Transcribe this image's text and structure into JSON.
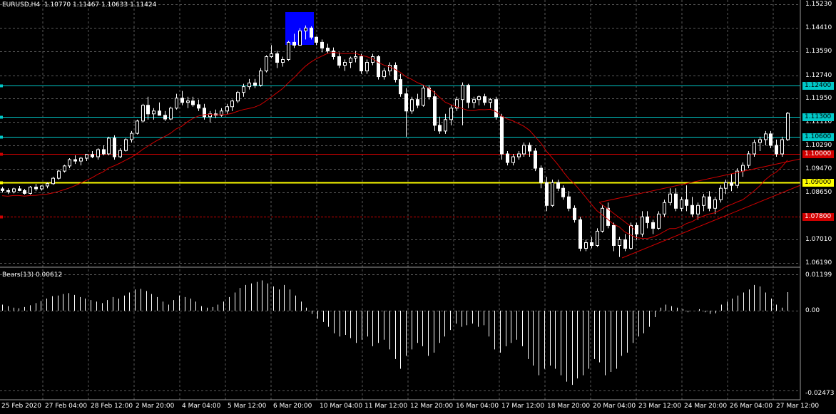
{
  "header": {
    "symbol": "EURUSD,H4",
    "ohlc": "1.10770 1.11467 1.10633 1.11424"
  },
  "indicator": {
    "label": "Bears(13) 0.00612",
    "scale": [
      "0.01199",
      "0.00",
      "-0.02473"
    ]
  },
  "price_axis": [
    "1.15230",
    "1.14410",
    "1.13590",
    "1.12740",
    "1.11950",
    "1.11110",
    "1.10290",
    "1.09470",
    "1.08650",
    "1.07010",
    "1.06190"
  ],
  "hlines": [
    {
      "label": "1.12400",
      "price": 1.124,
      "color": "#00c8c8",
      "text": "#000000"
    },
    {
      "label": "1.11300",
      "price": 1.113,
      "color": "#00c8c8",
      "text": "#000000"
    },
    {
      "label": "1.10600",
      "price": 1.106,
      "color": "#00c8c8",
      "text": "#000000"
    },
    {
      "label": "1.10000",
      "price": 1.1,
      "color": "#d00000",
      "text": "#ffffff"
    },
    {
      "label": "1.09000",
      "price": 1.09,
      "color": "#ffff00",
      "text": "#000000"
    },
    {
      "label": "1.07800",
      "price": 1.078,
      "color": "#d00000",
      "text": "#ffffff",
      "dashed": true
    }
  ],
  "time_axis": [
    "25 Feb 2020",
    "27 Feb 04:00",
    "28 Feb 12:00",
    "2 Mar 20:00",
    "4 Mar 04:00",
    "5 Mar 12:00",
    "6 Mar 20:00",
    "10 Mar 04:00",
    "11 Mar 12:00",
    "12 Mar 20:00",
    "16 Mar 04:00",
    "17 Mar 12:00",
    "18 Mar 20:00",
    "20 Mar 04:00",
    "23 Mar 12:00",
    "24 Mar 20:00",
    "26 Mar 04:00",
    "27 Mar 12:00"
  ],
  "colors": {
    "bull": "#ffffff",
    "bear": "#ffffff",
    "ma": "#d00000",
    "grid": "#5a5a5a",
    "trend": "#d00000",
    "highlight": "#0000ff"
  },
  "ma_period": 13,
  "candles": [
    [
      1.0878,
      1.0885,
      1.0865,
      1.0872
    ],
    [
      1.0872,
      1.088,
      1.086,
      1.0868
    ],
    [
      1.0868,
      1.0882,
      1.0862,
      1.0878
    ],
    [
      1.0878,
      1.0888,
      1.087,
      1.0872
    ],
    [
      1.0872,
      1.0878,
      1.0858,
      1.0862
    ],
    [
      1.0862,
      1.0888,
      1.0858,
      1.0884
    ],
    [
      1.0884,
      1.0895,
      1.087,
      1.0878
    ],
    [
      1.0878,
      1.089,
      1.0872,
      1.0888
    ],
    [
      1.0888,
      1.09,
      1.088,
      1.0896
    ],
    [
      1.0896,
      1.092,
      1.0892,
      1.0915
    ],
    [
      1.0915,
      1.0945,
      1.091,
      1.094
    ],
    [
      1.094,
      1.0962,
      1.0935,
      1.0958
    ],
    [
      1.0958,
      1.0985,
      1.095,
      1.098
    ],
    [
      1.098,
      1.0995,
      1.0965,
      1.0975
    ],
    [
      1.0975,
      1.099,
      1.096,
      1.0985
    ],
    [
      1.0985,
      1.1,
      1.0975,
      1.0998
    ],
    [
      1.0998,
      1.101,
      1.0985,
      1.099
    ],
    [
      1.099,
      1.102,
      1.098,
      1.1015
    ],
    [
      1.1015,
      1.103,
      1.0995,
      1.1
    ],
    [
      1.1,
      1.106,
      1.0995,
      1.1055
    ],
    [
      1.1055,
      1.1065,
      1.098,
      1.099
    ],
    [
      1.099,
      1.102,
      1.0985,
      1.1012
    ],
    [
      1.1012,
      1.1055,
      1.1008,
      1.105
    ],
    [
      1.105,
      1.108,
      1.104,
      1.1072
    ],
    [
      1.1072,
      1.112,
      1.1068,
      1.1115
    ],
    [
      1.1115,
      1.1175,
      1.111,
      1.117
    ],
    [
      1.117,
      1.12,
      1.112,
      1.114
    ],
    [
      1.114,
      1.116,
      1.112,
      1.115
    ],
    [
      1.115,
      1.118,
      1.114,
      1.1135
    ],
    [
      1.1135,
      1.115,
      1.1115,
      1.1122
    ],
    [
      1.1122,
      1.1165,
      1.1118,
      1.116
    ],
    [
      1.116,
      1.121,
      1.1155,
      1.1195
    ],
    [
      1.1195,
      1.122,
      1.117,
      1.118
    ],
    [
      1.118,
      1.12,
      1.116,
      1.1185
    ],
    [
      1.1185,
      1.12,
      1.1165,
      1.1172
    ],
    [
      1.1172,
      1.119,
      1.115,
      1.116
    ],
    [
      1.116,
      1.1175,
      1.112,
      1.113
    ],
    [
      1.113,
      1.115,
      1.111,
      1.114
    ],
    [
      1.114,
      1.1155,
      1.1125,
      1.1135
    ],
    [
      1.1135,
      1.116,
      1.113,
      1.115
    ],
    [
      1.115,
      1.1175,
      1.114,
      1.1165
    ],
    [
      1.1165,
      1.119,
      1.115,
      1.1185
    ],
    [
      1.1185,
      1.122,
      1.1178,
      1.1215
    ],
    [
      1.1215,
      1.1245,
      1.12,
      1.1235
    ],
    [
      1.1235,
      1.1262,
      1.1225,
      1.1248
    ],
    [
      1.1248,
      1.1262,
      1.123,
      1.124
    ],
    [
      1.124,
      1.13,
      1.1235,
      1.129
    ],
    [
      1.129,
      1.1345,
      1.1285,
      1.134
    ],
    [
      1.134,
      1.138,
      1.1335,
      1.135
    ],
    [
      1.135,
      1.136,
      1.13,
      1.132
    ],
    [
      1.132,
      1.134,
      1.1305,
      1.133
    ],
    [
      1.133,
      1.1395,
      1.1325,
      1.139
    ],
    [
      1.139,
      1.142,
      1.137,
      1.138
    ],
    [
      1.138,
      1.144,
      1.1378,
      1.143
    ],
    [
      1.143,
      1.1449,
      1.14,
      1.144
    ],
    [
      1.144,
      1.1446,
      1.14,
      1.1408
    ],
    [
      1.1408,
      1.141,
      1.138,
      1.139
    ],
    [
      1.139,
      1.14,
      1.1355,
      1.137
    ],
    [
      1.137,
      1.1385,
      1.135,
      1.136
    ],
    [
      1.136,
      1.1372,
      1.133,
      1.134
    ],
    [
      1.134,
      1.1355,
      1.13,
      1.131
    ],
    [
      1.131,
      1.133,
      1.129,
      1.132
    ],
    [
      1.132,
      1.134,
      1.13,
      1.1335
    ],
    [
      1.1335,
      1.136,
      1.132,
      1.134
    ],
    [
      1.134,
      1.135,
      1.128,
      1.129
    ],
    [
      1.129,
      1.133,
      1.128,
      1.132
    ],
    [
      1.132,
      1.135,
      1.131,
      1.134
    ],
    [
      1.134,
      1.1345,
      1.126,
      1.127
    ],
    [
      1.127,
      1.13,
      1.126,
      1.129
    ],
    [
      1.129,
      1.132,
      1.1275,
      1.131
    ],
    [
      1.131,
      1.132,
      1.125,
      1.126
    ],
    [
      1.126,
      1.128,
      1.12,
      1.121
    ],
    [
      1.121,
      1.123,
      1.106,
      1.115
    ],
    [
      1.115,
      1.12,
      1.114,
      1.119
    ],
    [
      1.119,
      1.121,
      1.116,
      1.117
    ],
    [
      1.117,
      1.124,
      1.1165,
      1.123
    ],
    [
      1.123,
      1.124,
      1.119,
      1.12
    ],
    [
      1.12,
      1.122,
      1.108,
      1.11
    ],
    [
      1.11,
      1.113,
      1.107,
      1.108
    ],
    [
      1.108,
      1.114,
      1.107,
      1.112
    ],
    [
      1.112,
      1.117,
      1.11,
      1.116
    ],
    [
      1.116,
      1.12,
      1.115,
      1.119
    ],
    [
      1.119,
      1.125,
      1.11,
      1.124
    ],
    [
      1.124,
      1.1245,
      1.116,
      1.118
    ],
    [
      1.118,
      1.12,
      1.116,
      1.119
    ],
    [
      1.119,
      1.1205,
      1.117,
      1.12
    ],
    [
      1.12,
      1.121,
      1.117,
      1.118
    ],
    [
      1.118,
      1.1195,
      1.116,
      1.119
    ],
    [
      1.119,
      1.12,
      1.112,
      1.113
    ],
    [
      1.113,
      1.114,
      1.098,
      1.1
    ],
    [
      1.1,
      1.101,
      1.096,
      1.097
    ],
    [
      1.097,
      1.1,
      1.096,
      1.099
    ],
    [
      1.099,
      1.101,
      1.098,
      1.1
    ],
    [
      1.1,
      1.104,
      1.099,
      1.103
    ],
    [
      1.103,
      1.104,
      1.099,
      1.101
    ],
    [
      1.101,
      1.102,
      1.094,
      1.095
    ],
    [
      1.095,
      1.096,
      1.088,
      1.09
    ],
    [
      1.09,
      1.092,
      1.08,
      1.082
    ],
    [
      1.082,
      1.091,
      1.0815,
      1.09
    ],
    [
      1.09,
      1.091,
      1.087,
      1.088
    ],
    [
      1.088,
      1.089,
      1.084,
      1.085
    ],
    [
      1.085,
      1.087,
      1.08,
      1.081
    ],
    [
      1.081,
      1.082,
      1.076,
      1.077
    ],
    [
      1.077,
      1.078,
      1.066,
      1.067
    ],
    [
      1.067,
      1.07,
      1.066,
      1.069
    ],
    [
      1.069,
      1.071,
      1.067,
      1.068
    ],
    [
      1.068,
      1.074,
      1.0675,
      1.073
    ],
    [
      1.073,
      1.082,
      1.0725,
      1.081
    ],
    [
      1.081,
      1.083,
      1.074,
      1.075
    ],
    [
      1.075,
      1.076,
      1.066,
      1.068
    ],
    [
      1.068,
      1.071,
      1.064,
      1.07
    ],
    [
      1.07,
      1.072,
      1.066,
      1.067
    ],
    [
      1.067,
      1.076,
      1.0665,
      1.075
    ],
    [
      1.075,
      1.076,
      1.07,
      1.072
    ],
    [
      1.072,
      1.08,
      1.071,
      1.078
    ],
    [
      1.078,
      1.08,
      1.074,
      1.076
    ],
    [
      1.076,
      1.077,
      1.072,
      1.074
    ],
    [
      1.074,
      1.08,
      1.0735,
      1.079
    ],
    [
      1.079,
      1.084,
      1.078,
      1.083
    ],
    [
      1.083,
      1.088,
      1.082,
      1.086
    ],
    [
      1.086,
      1.088,
      1.08,
      1.081
    ],
    [
      1.081,
      1.085,
      1.08,
      1.084
    ],
    [
      1.084,
      1.089,
      1.08,
      1.082
    ],
    [
      1.082,
      1.085,
      1.078,
      1.079
    ],
    [
      1.079,
      1.083,
      1.077,
      1.082
    ],
    [
      1.082,
      1.086,
      1.08,
      1.085
    ],
    [
      1.085,
      1.087,
      1.08,
      1.081
    ],
    [
      1.081,
      1.085,
      1.079,
      1.084
    ],
    [
      1.084,
      1.089,
      1.083,
      1.088
    ],
    [
      1.088,
      1.091,
      1.086,
      1.09
    ],
    [
      1.09,
      1.093,
      1.087,
      1.089
    ],
    [
      1.089,
      1.095,
      1.088,
      1.094
    ],
    [
      1.094,
      1.097,
      1.092,
      1.096
    ],
    [
      1.096,
      1.101,
      1.095,
      1.1
    ],
    [
      1.1,
      1.105,
      1.099,
      1.104
    ],
    [
      1.104,
      1.106,
      1.101,
      1.105
    ],
    [
      1.105,
      1.108,
      1.103,
      1.107
    ],
    [
      1.107,
      1.108,
      1.102,
      1.103
    ],
    [
      1.103,
      1.105,
      1.099,
      1.1
    ],
    [
      1.1,
      1.106,
      1.099,
      1.105
    ],
    [
      1.105,
      1.1147,
      1.1045,
      1.1142
    ]
  ],
  "bears": [
    0.002,
    0.0015,
    0.001,
    0.0008,
    0.0012,
    0.0018,
    0.0025,
    0.0032,
    0.004,
    0.0048,
    0.005,
    0.0055,
    0.0058,
    0.0052,
    0.0045,
    0.004,
    0.0035,
    0.003,
    0.0025,
    0.0035,
    0.0045,
    0.004,
    0.005,
    0.006,
    0.007,
    0.0072,
    0.0065,
    0.0055,
    0.0045,
    0.003,
    0.002,
    0.0035,
    0.005,
    0.0045,
    0.004,
    0.003,
    0.0015,
    0.001,
    0.0012,
    0.002,
    0.003,
    0.0045,
    0.006,
    0.0075,
    0.0085,
    0.009,
    0.0095,
    0.01,
    0.009,
    0.008,
    0.007,
    0.0085,
    0.007,
    0.005,
    0.003,
    0.001,
    -0.001,
    -0.0025,
    -0.0035,
    -0.005,
    -0.007,
    -0.008,
    -0.0075,
    -0.0085,
    -0.01,
    -0.009,
    -0.008,
    -0.011,
    -0.01,
    -0.009,
    -0.012,
    -0.015,
    -0.018,
    -0.014,
    -0.012,
    -0.01,
    -0.011,
    -0.014,
    -0.013,
    -0.01,
    -0.008,
    -0.006,
    -0.004,
    -0.005,
    -0.0045,
    -0.004,
    -0.005,
    -0.0045,
    -0.008,
    -0.012,
    -0.013,
    -0.011,
    -0.01,
    -0.009,
    -0.011,
    -0.015,
    -0.017,
    -0.02,
    -0.018,
    -0.017,
    -0.018,
    -0.02,
    -0.022,
    -0.023,
    -0.021,
    -0.02,
    -0.018,
    -0.015,
    -0.016,
    -0.02,
    -0.019,
    -0.018,
    -0.014,
    -0.013,
    -0.01,
    -0.008,
    -0.007,
    -0.005,
    -0.002,
    0.001,
    0.002,
    0.0015,
    0.001,
    0.0005,
    -0.0005,
    0.0,
    0.0005,
    -0.0005,
    -0.001,
    -0.0008,
    0.002,
    0.003,
    0.004,
    0.005,
    0.006,
    0.007,
    0.0085,
    0.008,
    0.006,
    0.004,
    0.002,
    0.001,
    0.0061
  ]
}
